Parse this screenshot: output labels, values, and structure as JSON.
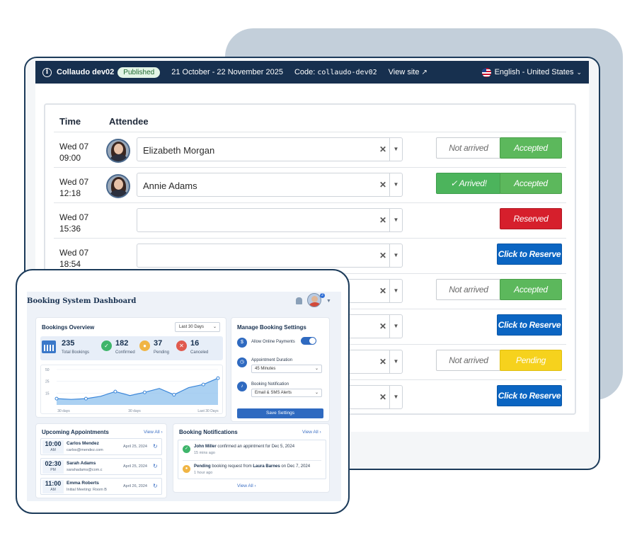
{
  "topbar": {
    "event_name": "Collaudo dev02",
    "status_badge": "Published",
    "dates": "21 October - 22 November 2025",
    "code_label": "Code:",
    "code_value": "collaudo-dev02",
    "view_site": "View site",
    "language": "English - United States"
  },
  "table": {
    "headers": {
      "time": "Time",
      "attendee": "Attendee"
    },
    "rows": [
      {
        "day": "Wed 07",
        "time": "09:00",
        "attendee": "Elizabeth Morgan",
        "has_avatar": true,
        "buttons": [
          "Not arrived",
          "Accepted"
        ]
      },
      {
        "day": "Wed 07",
        "time": "12:18",
        "attendee": "Annie Adams",
        "has_avatar": true,
        "buttons": [
          "✓ Arrived!",
          "Accepted"
        ]
      },
      {
        "day": "Wed 07",
        "time": "15:36",
        "attendee": "",
        "has_avatar": false,
        "buttons": [
          "Reserved"
        ]
      },
      {
        "day": "Wed 07",
        "time": "18:54",
        "attendee": "",
        "has_avatar": false,
        "buttons": [
          "Click to Reserve"
        ]
      },
      {
        "day": "",
        "time": "",
        "attendee": "",
        "has_avatar": false,
        "buttons": [
          "Not arrived",
          "Accepted"
        ]
      },
      {
        "day": "",
        "time": "",
        "attendee": "",
        "has_avatar": false,
        "buttons": [
          "Click to Reserve"
        ]
      },
      {
        "day": "",
        "time": "",
        "attendee": "",
        "has_avatar": false,
        "buttons": [
          "Not arrived",
          "Pending"
        ]
      },
      {
        "day": "",
        "time": "",
        "attendee": "",
        "has_avatar": false,
        "buttons": [
          "Click to Reserve"
        ]
      }
    ]
  },
  "dashboard": {
    "title": "Booking System Dashboard",
    "notification_count": "2",
    "overview": {
      "title": "Bookings Overview",
      "range": "Last 30 Days",
      "stats": [
        {
          "value": "235",
          "label": "Total Bookings"
        },
        {
          "value": "182",
          "label": "Confirmed"
        },
        {
          "value": "37",
          "label": "Pending"
        },
        {
          "value": "16",
          "label": "Canceled"
        }
      ]
    },
    "chart_data": {
      "type": "area",
      "y_ticks": [
        "50",
        "25",
        "15"
      ],
      "x_labels": [
        "30 days",
        "30 days",
        "Last 30 Days"
      ],
      "values": [
        8,
        7,
        8,
        11,
        17,
        12,
        16,
        21,
        13,
        22,
        26,
        34
      ],
      "ylim": [
        0,
        45
      ]
    },
    "settings": {
      "title": "Manage Booking Settings",
      "allow_payments": "Allow Online Payments",
      "duration_label": "Appointment Duration",
      "duration_value": "45 Minutes",
      "notification_label": "Booking Notification",
      "notification_value": "Email & SMS Alerts",
      "save": "Save Settings"
    },
    "appointments": {
      "title": "Upcoming Appointments",
      "view_all": "View All",
      "items": [
        {
          "time": "10:00",
          "ampm": "AM",
          "name": "Carlos Mendez",
          "detail": "carlos@mendez.com",
          "date": "April 25, 2024"
        },
        {
          "time": "02:30",
          "ampm": "PM",
          "name": "Sarah Adams",
          "detail": "sarahadams@com.c",
          "date": "April 25, 2024"
        },
        {
          "time": "11:00",
          "ampm": "AM",
          "name": "Emma Roberts",
          "detail": "Initial Meeting: Room B",
          "date": "April 26, 2024"
        }
      ]
    },
    "notifications": {
      "title": "Booking Notifications",
      "view_all": "View All",
      "items": [
        {
          "actor": "John Miller",
          "text": " confirmed an appintment for Dec 5, 2024",
          "time": "15 mins ago"
        },
        {
          "actor": "Pending",
          "text_pre": " booking request from ",
          "actor2": "Laura Barnes",
          "text_post": " on Dec 7, 2024",
          "time": "1 hour ago"
        }
      ],
      "footer": "View All"
    }
  },
  "colors": {
    "navy": "#17304f",
    "accepted": "#5cb85c",
    "reserved": "#d61f2c",
    "reserve": "#0b65c2",
    "pending": "#f6d21d"
  }
}
